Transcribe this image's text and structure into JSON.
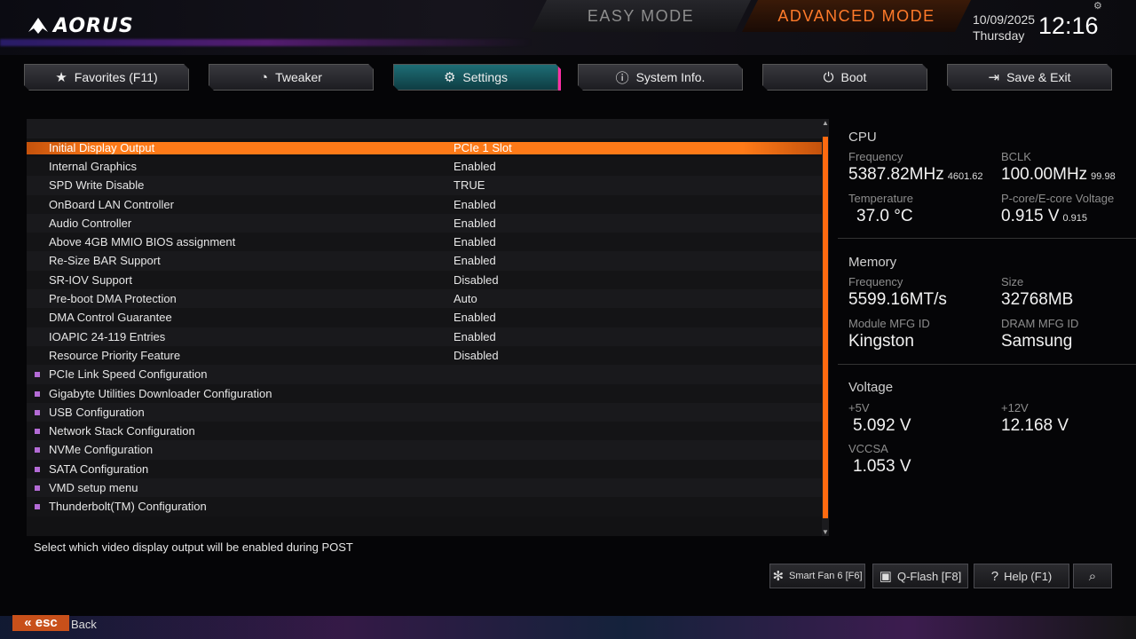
{
  "brand": {
    "logo_text": "AORUS"
  },
  "modes": {
    "easy": "EASY MODE",
    "advanced": "ADVANCED MODE"
  },
  "datetime": {
    "date": "10/09/2025",
    "day": "Thursday",
    "time": "12:16"
  },
  "tabs": [
    {
      "label": "Favorites (F11)",
      "icon": "star-icon"
    },
    {
      "label": "Tweaker",
      "icon": "speedometer-icon"
    },
    {
      "label": "Settings",
      "icon": "gear-icon"
    },
    {
      "label": "System Info.",
      "icon": "info-icon"
    },
    {
      "label": "Boot",
      "icon": "power-icon"
    },
    {
      "label": "Save & Exit",
      "icon": "exit-icon"
    }
  ],
  "settings": [
    {
      "label": "Initial Display Output",
      "value": "PCIe 1 Slot"
    },
    {
      "label": "Internal Graphics",
      "value": "Enabled"
    },
    {
      "label": "SPD Write Disable",
      "value": "TRUE"
    },
    {
      "label": "OnBoard LAN Controller",
      "value": "Enabled"
    },
    {
      "label": "Audio Controller",
      "value": "Enabled"
    },
    {
      "label": "Above 4GB MMIO BIOS assignment",
      "value": "Enabled"
    },
    {
      "label": "Re-Size BAR Support",
      "value": "Enabled"
    },
    {
      "label": "SR-IOV Support",
      "value": "Disabled"
    },
    {
      "label": "Pre-boot DMA Protection",
      "value": "Auto"
    },
    {
      "label": "DMA Control Guarantee",
      "value": "Enabled"
    },
    {
      "label": "IOAPIC 24-119 Entries",
      "value": "Enabled"
    },
    {
      "label": "Resource Priority Feature",
      "value": "Disabled"
    }
  ],
  "submenus": [
    "PCIe Link Speed Configuration",
    "Gigabyte Utilities Downloader Configuration",
    "USB Configuration",
    "Network Stack Configuration",
    "NVMe Configuration",
    "SATA Configuration",
    "VMD setup menu",
    "Thunderbolt(TM) Configuration"
  ],
  "help_text": "Select which video display output will be enabled during POST",
  "cpu": {
    "title": "CPU",
    "frequency_label": "Frequency",
    "frequency": "5387.82MHz",
    "frequency_sub": "4601.62",
    "bclk_label": "BCLK",
    "bclk": "100.00MHz",
    "bclk_sub": "99.98",
    "temp_label": "Temperature",
    "temp": "37.0 °C",
    "voltage_label": "P-core/E-core Voltage",
    "voltage": "0.915 V",
    "voltage_sub": "0.915"
  },
  "memory": {
    "title": "Memory",
    "frequency_label": "Frequency",
    "frequency": "5599.16MT/s",
    "size_label": "Size",
    "size": "32768MB",
    "module_label": "Module MFG ID",
    "module": "Kingston",
    "dram_label": "DRAM MFG ID",
    "dram": "Samsung"
  },
  "voltage": {
    "title": "Voltage",
    "v5_label": "+5V",
    "v5": "5.092 V",
    "v12_label": "+12V",
    "v12": "12.168 V",
    "vccsa_label": "VCCSA",
    "vccsa": "1.053 V"
  },
  "bottom": {
    "smart_fan": "Smart Fan 6 [F6]",
    "qflash": "Q-Flash [F8]",
    "help": "Help (F1)",
    "esc": "esc",
    "back": "Back"
  },
  "colors": {
    "accent": "#ff7a18",
    "active_tab": "#1e6f77",
    "highlight_pink": "#ff2fa8"
  }
}
